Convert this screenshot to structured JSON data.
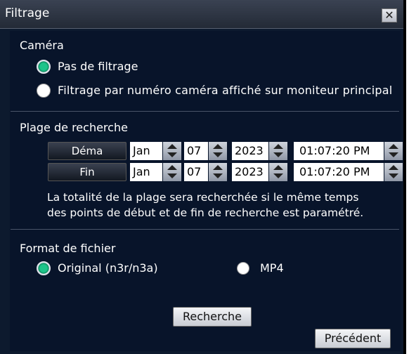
{
  "window": {
    "title": "Filtrage",
    "close_label": "✕"
  },
  "camera": {
    "heading": "Caméra",
    "options": [
      {
        "label": "Pas de filtrage",
        "selected": true
      },
      {
        "label": "Filtrage par numéro caméra affiché sur moniteur principal",
        "selected": false
      }
    ]
  },
  "range": {
    "heading": "Plage de recherche",
    "start": {
      "label": "Déma",
      "month": "Jan",
      "day": "07",
      "year": "2023",
      "time": "01:07:20 PM"
    },
    "end": {
      "label": "Fin",
      "month": "Jan",
      "day": "07",
      "year": "2023",
      "time": "01:07:20 PM"
    },
    "note_line1": "La totalité de la plage sera recherchée si le même temps",
    "note_line2": "des points de début et de fin de recherche est paramétré."
  },
  "format": {
    "heading": "Format de fichier",
    "options": [
      {
        "label": "Original (n3r/n3a)",
        "selected": true
      },
      {
        "label": "MP4",
        "selected": false
      }
    ]
  },
  "buttons": {
    "search": "Recherche",
    "previous": "Précédent"
  },
  "colors": {
    "panel_bg": "#08142a",
    "radio_selected": "#1ec48a"
  }
}
